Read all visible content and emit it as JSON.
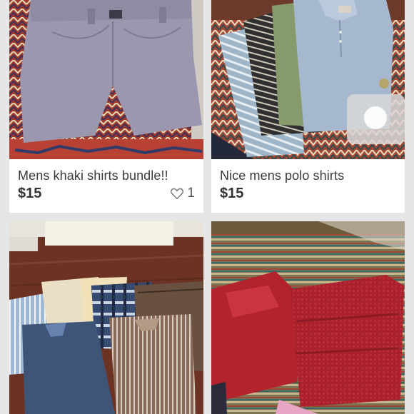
{
  "listings": [
    {
      "title": "Mens khaki shirts bundle!!",
      "price": "$15",
      "likes": "1",
      "icon": "heart-icon"
    },
    {
      "title": "Nice mens polo shirts",
      "price": "$15"
    },
    {},
    {}
  ],
  "colors": {
    "title_text": "#3a3a3a",
    "price_text": "#333333",
    "card_bg": "#ffffff",
    "page_bg": "#e6e6e6"
  }
}
